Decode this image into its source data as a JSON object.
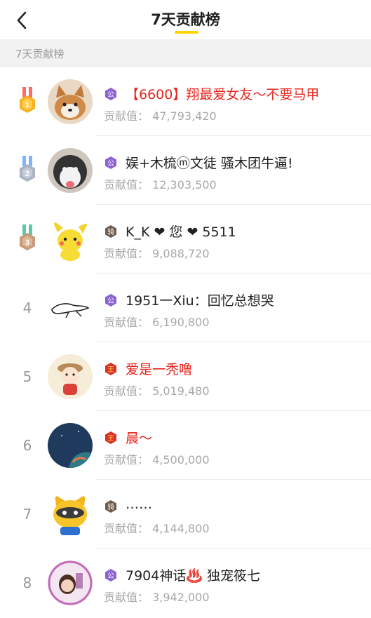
{
  "header": {
    "title": "7天贡献榜"
  },
  "section": {
    "label": "7天贡献榜"
  },
  "score_label": "贡献值：",
  "colors": {
    "accent": "#ffd500",
    "name_red": "#e8251d",
    "gold": "#f5b324",
    "silver": "#a9b4c2",
    "bronze": "#c99a7a"
  },
  "rows": [
    {
      "rank": "1",
      "badge": "公",
      "name": "【6600】翔最爱女友～不要马甲",
      "name_color": "red",
      "score": "47,793,420"
    },
    {
      "rank": "2",
      "badge": "公",
      "name": "娱+木梳ⓜ文徒 骚木团牛逼!",
      "name_color": "black",
      "score": "12,303,500"
    },
    {
      "rank": "3",
      "badge": "骑",
      "name": "K_K ❤ 您 ❤ 5511",
      "name_color": "black",
      "score": "9,088,720"
    },
    {
      "rank": "4",
      "badge": "公",
      "name": "1951一Xiu：回忆总想哭",
      "name_color": "black",
      "score": "6,190,800"
    },
    {
      "rank": "5",
      "badge": "王",
      "name": "爱是一秃噜",
      "name_color": "red",
      "score": "5,019,480"
    },
    {
      "rank": "6",
      "badge": "王",
      "name": "晨～",
      "name_color": "red",
      "score": "4,500,000"
    },
    {
      "rank": "7",
      "badge": "骑",
      "name": "……",
      "name_color": "black",
      "score": "4,144,800"
    },
    {
      "rank": "8",
      "badge": "公",
      "name": "7904神话♨️ 独宠筱七",
      "name_color": "black",
      "score": "3,942,000"
    }
  ]
}
